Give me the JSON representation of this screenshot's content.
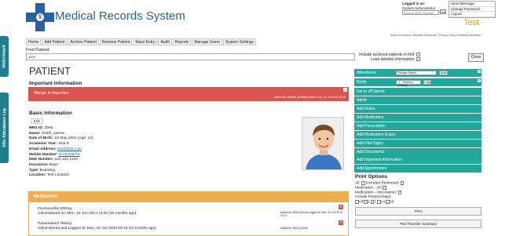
{
  "side_tabs": {
    "noticeboard": "Noticeboard",
    "attendance_log": "24hr Attendance Log"
  },
  "header": {
    "app_title": "Medical Records System",
    "title_suffix": "",
    "logged_in_label": "Logged in as:",
    "logged_in_user": "System Administrator",
    "search_placeholder": "Search NHS Choices",
    "go_label": "Go",
    "account_links": [
      "Send Message",
      "Change Password",
      "Logout"
    ],
    "environment": "Test",
    "footer_links": "Admin Functions | Website Disclaimer | Privacy Policy | Medical Disclaimer"
  },
  "nav": [
    "Home",
    "Add Patient",
    "Archive Patient",
    "Remove Patient",
    "Mass Entry",
    "Audit",
    "Reports",
    "Manage Users",
    "System Settings"
  ],
  "find": {
    "label": "Find Patient:",
    "value": "2504",
    "archived_label_1": "Include archived patients in find:",
    "archived_label_2": "Load deleted information:",
    "close_label": "Close"
  },
  "patient": {
    "heading": "PATIENT",
    "important_heading": "Important Information",
    "allergy_text": "Allergic to Ibuprofen",
    "allergy_meta": "Added By: ADMIN (ADMIN)  Added: Tue, 21 Jul 2015 10:18",
    "basic_heading": "Basic Information",
    "edit_label": "Edit",
    "fields": [
      {
        "label": "MRS ID:",
        "value": "2504"
      },
      {
        "label": "Name:",
        "value": "Smith, James"
      },
      {
        "label": "Date of Birth:",
        "value": "1st May 2001 (Age: 13)"
      },
      {
        "label": "Academic Year:",
        "value": "Year 9"
      },
      {
        "label": "Email Address:",
        "value": "test@test.com",
        "link": true
      },
      {
        "label": "Mobile Number:",
        "value": "0712345678",
        "link": true
      },
      {
        "label": "NHS Number:",
        "value": "123 123 1234"
      },
      {
        "label": "Insurance:",
        "value": "Bupa"
      },
      {
        "label": "Type:",
        "value": "Boarding"
      },
      {
        "label": "Location:",
        "value": "Test Location"
      }
    ]
  },
  "medication": {
    "heading": "Medication",
    "items": [
      {
        "name": "Flucloxacillin 500mg",
        "detail": "Administered on: Mon, 16 Jun 2014 13:00 (10 months ago)",
        "meta": "Added by: MDIX (None)  Logged at: Mon, 16 Jun 2014 14:27"
      },
      {
        "name": "Paracetamol 750mg",
        "detail": "Administered and Logged at: Mon, 16 Jun 2014 09:16 (10 months ago)",
        "meta": "Added by: MDIX (None)"
      }
    ]
  },
  "right_panel": {
    "attendance_label": "Attendance",
    "attendance_select": "Please Select...",
    "notify_label": "Notify",
    "notify_select": "1 - Medium Priority",
    "actions": [
      "Set to off Sports",
      "Admit",
      "Add Notes",
      "Add Medication",
      "Add Prescription",
      "Add Medication Expiry",
      "Add Vital Signs",
      "Add Documents",
      "Add Important Information",
      "Add Appointment"
    ],
    "add_label": "Add",
    "log_label": "Log",
    "print_heading": "Print Options",
    "print_all": "All:",
    "print_restricted": "Included Restricted:",
    "print_med_all": "Medication - All:",
    "print_med_vacc": "Medication - Vaccination:",
    "passed_days_label": "Include Passed Days:",
    "passed_days": [
      "All",
      "2",
      "7",
      "14",
      "28"
    ],
    "print_button": "Print",
    "print_transfer_button": "Print Transfer Summary"
  }
}
